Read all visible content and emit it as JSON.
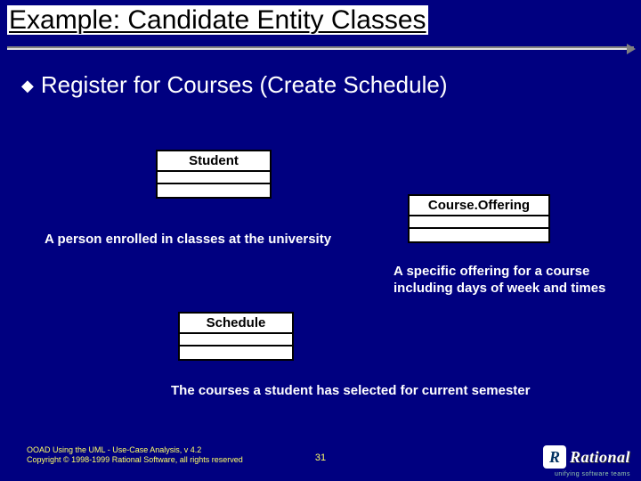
{
  "title": "Example: Candidate Entity Classes",
  "bullet": "Register for Courses (Create Schedule)",
  "entities": {
    "student": {
      "name": "Student",
      "desc": "A person enrolled in classes at the university"
    },
    "course_offering": {
      "name": "Course.Offering",
      "desc": "A specific offering for a course including days of week and times"
    },
    "schedule": {
      "name": "Schedule",
      "desc": "The courses a student has selected for current semester"
    }
  },
  "footer": {
    "line1": "OOAD Using the UML - Use-Case Analysis, v 4.2",
    "line2": "Copyright © 1998-1999 Rational Software, all rights reserved"
  },
  "page_number": "31",
  "logo": {
    "mark": "R",
    "text": "Rational",
    "sub": "unifying software teams"
  }
}
